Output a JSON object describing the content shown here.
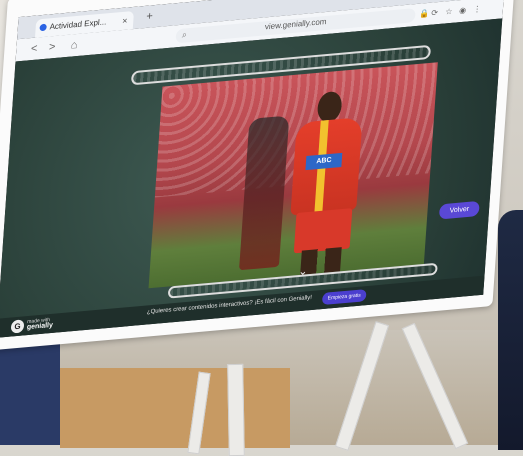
{
  "browser": {
    "tab_title": "Actividad Expl...",
    "tab_close": "×",
    "new_tab": "+",
    "url": "view.genially.com",
    "nav": {
      "back": "<",
      "forward": ">",
      "home": "⌂"
    },
    "icons": {
      "search": "⌕",
      "lock": "🔒",
      "reload": "⟳",
      "star": "☆",
      "profile": "◉",
      "menu": "⋮"
    }
  },
  "presentation": {
    "player_sponsor": "ABC",
    "back_button": "Volver",
    "down_arrow": "⌄"
  },
  "footer": {
    "message": "¿Quieres crear contenidos interactivos? ¡Es fácil con Genially!",
    "cta": "Empieza gratis",
    "brand_small": "made with",
    "brand_name": "genially",
    "brand_logo": "G"
  },
  "colors": {
    "accent": "#5a48d6",
    "board_green": "#3e5a52",
    "jersey_red": "#e43e2a",
    "jersey_yellow": "#f2c12e"
  }
}
